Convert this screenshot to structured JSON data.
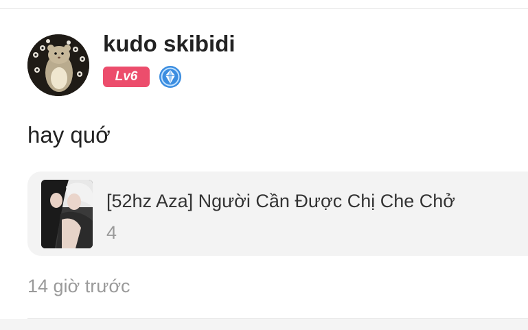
{
  "comment": {
    "username": "kudo skibidi",
    "level_badge": "Lv6",
    "avatar_icon": "hamster-avatar-icon",
    "rank_badge_icon": "diamond-rank-badge-icon",
    "text": "hay quớ",
    "timestamp": "14 giờ trước"
  },
  "story": {
    "title": "[52hz Aza] Người Cần Được Chị Che Chở",
    "count": "4",
    "cover_icon": "story-cover-image"
  },
  "colors": {
    "level_badge_bg": "#ec4d6c",
    "rank_badge": "#3b8de0",
    "card_bg": "#f3f3f3",
    "muted_text": "#9a9a9a",
    "primary_text": "#222222"
  }
}
